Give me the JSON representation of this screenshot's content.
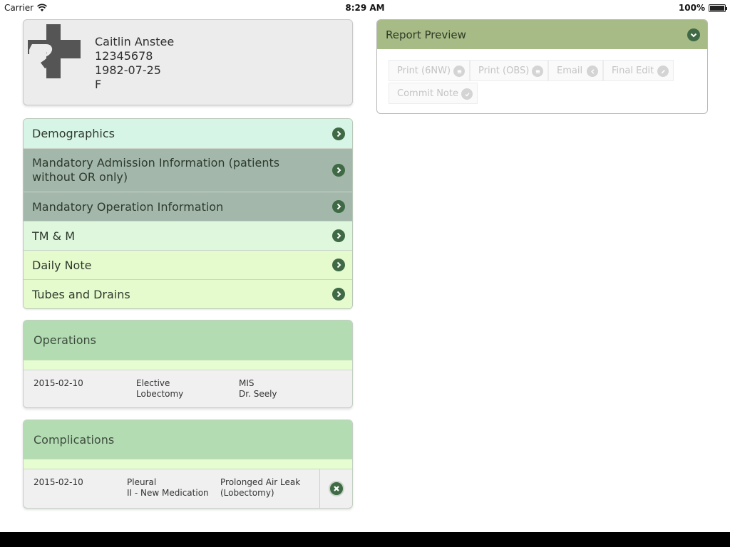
{
  "status_bar": {
    "carrier": "Carrier",
    "time": "8:29 AM",
    "battery": "100%"
  },
  "patient": {
    "name": "Caitlin Anstee",
    "id": "12345678",
    "dob": "1982-07-25",
    "sex": "F"
  },
  "menu": {
    "items": [
      {
        "label": "Demographics",
        "color": "#d7f5e6"
      },
      {
        "label": "Mandatory Admission Information (patients without OR only)",
        "color": "#a3b8ab"
      },
      {
        "label": "Mandatory Operation Information",
        "color": "#a3b8ab"
      },
      {
        "label": "TM & M",
        "color": "#dff7dc"
      },
      {
        "label": "Daily Note",
        "color": "#e6fbcd"
      },
      {
        "label": "Tubes and Drains",
        "color": "#e6fbcd"
      }
    ]
  },
  "operations": {
    "title": "Operations",
    "rows": [
      {
        "date": "2015-02-10",
        "type_line1": "Elective",
        "type_line2": "Lobectomy",
        "approach_line1": "MIS",
        "approach_line2": "Dr. Seely"
      }
    ]
  },
  "complications": {
    "title": "Complications",
    "rows": [
      {
        "date": "2015-02-10",
        "category_line1": "Pleural",
        "category_line2": "II - New Medication",
        "desc_line1": "Prolonged Air Leak",
        "desc_line2": "(Lobectomy)"
      }
    ]
  },
  "report_preview": {
    "title": "Report Preview",
    "buttons": [
      {
        "label": "Print (6NW)",
        "icon": "list-icon"
      },
      {
        "label": "Print (OBS)",
        "icon": "list-icon"
      },
      {
        "label": "Email",
        "icon": "send-icon"
      },
      {
        "label": "Final Edit",
        "icon": "pencil-icon"
      },
      {
        "label": "Commit Note",
        "icon": "check-icon"
      }
    ]
  },
  "colors": {
    "accent": "#3f6a45",
    "header_green": "#b3dcb3",
    "report_header": "#a7bb87"
  }
}
